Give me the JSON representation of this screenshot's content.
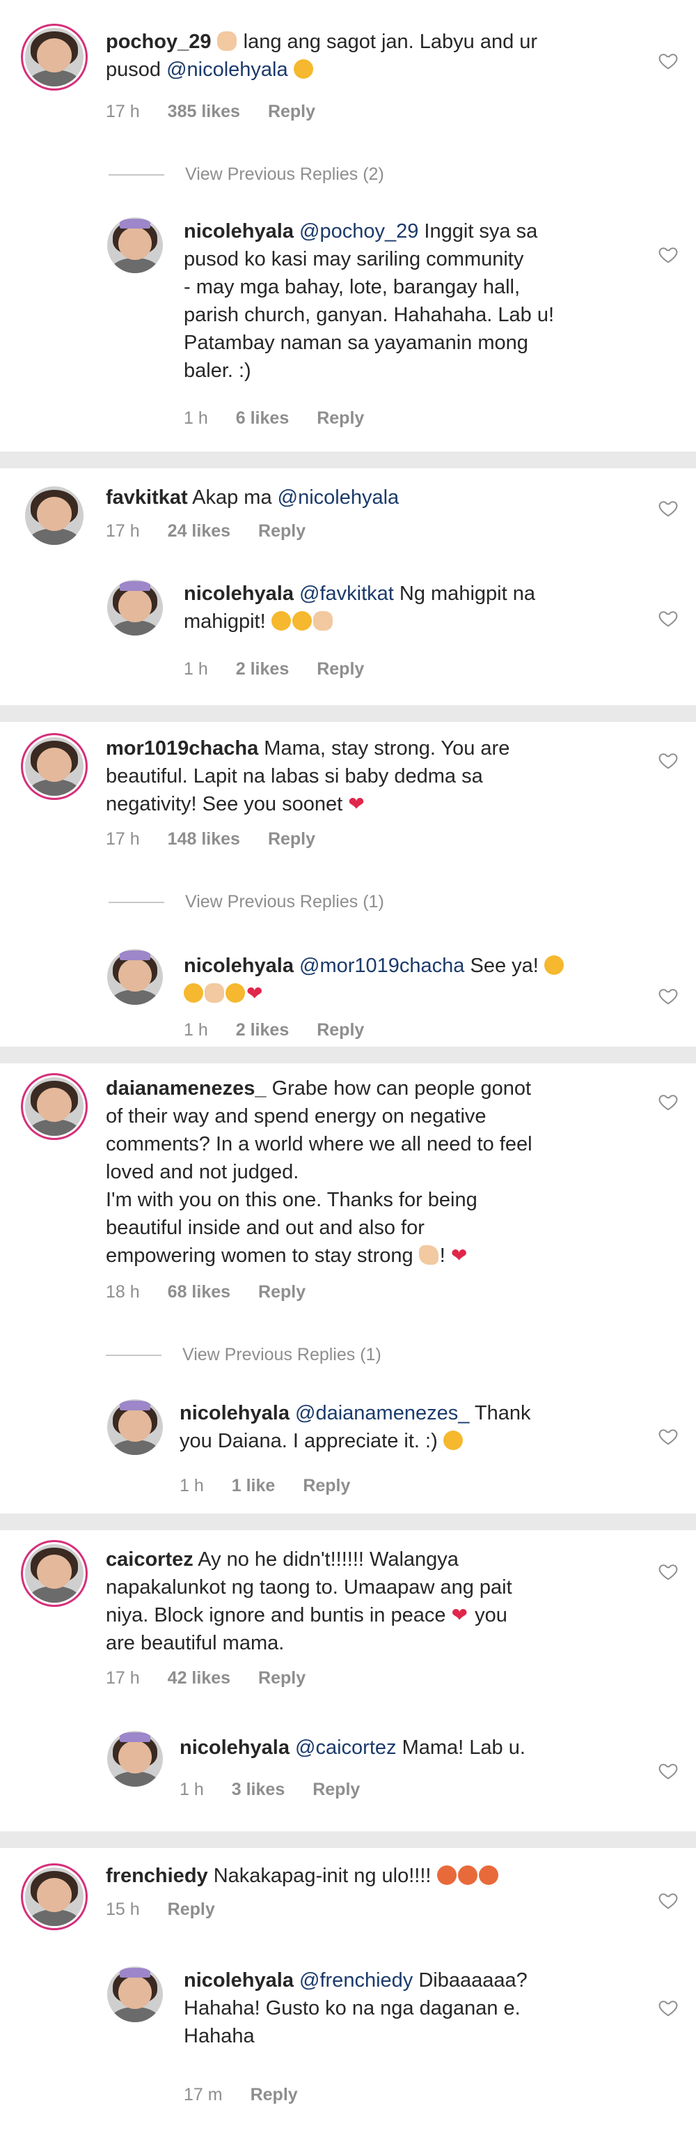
{
  "comments": [
    {
      "username": "pochoy_29",
      "text_before": " ",
      "text_after": " lang ang sagot jan. Labyu and ur\npusod ",
      "mention": "@nicolehyala",
      "time": "17 h",
      "likes": "385 likes",
      "reply_label": "Reply"
    },
    {
      "username": "nicolehyala",
      "mention": "@pochoy_29",
      "text": " Inggit sya sa\npusod ko kasi may sariling community\n- may mga bahay, lote, barangay hall,\nparish church, ganyan. Hahahaha. Lab u!\nPatambay naman sa yayamanin mong\nbaler. :)",
      "time": "1 h",
      "likes": "6 likes",
      "reply_label": "Reply"
    },
    {
      "username": "favkitkat",
      "text": " Akap ma ",
      "mention": "@nicolehyala",
      "time": "17 h",
      "likes": "24 likes",
      "reply_label": "Reply"
    },
    {
      "username": "nicolehyala",
      "mention": "@favkitkat",
      "text": " Ng mahigpit na\nmahigpit! ",
      "time": "1 h",
      "likes": "2 likes",
      "reply_label": "Reply"
    },
    {
      "username": "mor1019chacha",
      "text": " Mama, stay strong. You are\nbeautiful. Lapit na labas si baby dedma sa\nnegativity! See you soonet ",
      "time": "17 h",
      "likes": "148 likes",
      "reply_label": "Reply"
    },
    {
      "username": "nicolehyala",
      "mention": "@mor1019chacha",
      "text": " See ya! ",
      "time": "1 h",
      "likes": "2 likes",
      "reply_label": "Reply"
    },
    {
      "username": "daianamenezes_",
      "text": " Grabe how can people gonot\nof their way and spend energy on negative\ncomments? In a world where we all need to feel\nloved and not judged.\nI'm with you on this one. Thanks for being\nbeautiful inside and out and also for\nempowering women to stay strong ",
      "text_end": "!",
      "time": "18 h",
      "likes": "68 likes",
      "reply_label": "Reply"
    },
    {
      "username": "nicolehyala",
      "mention": "@daianamenezes_",
      "text": " Thank\nyou Daiana. I appreciate it. :) ",
      "time": "1 h",
      "likes": "1 like",
      "reply_label": "Reply"
    },
    {
      "username": "caicortez",
      "text": " Ay no he didn't!!!!!! Walangya\nnapakalunkot ng taong to. Umaapaw ang pait\nniya. Block ignore and buntis in peace ",
      "text_after": " you\nare beautiful mama.",
      "time": "17 h",
      "likes": "42 likes",
      "reply_label": "Reply"
    },
    {
      "username": "nicolehyala",
      "mention": "@caicortez",
      "text": " Mama! Lab u.",
      "time": "1 h",
      "likes": "3 likes",
      "reply_label": "Reply"
    },
    {
      "username": "frenchiedy",
      "text": " Nakakapag-init ng ulo!!!! ",
      "time": "15 h",
      "reply_label": "Reply"
    },
    {
      "username": "nicolehyala",
      "mention": "@frenchiedy",
      "text": " Dibaaaaaa?\nHahaha! Gusto ko na nga daganan e.\nHahaha",
      "time": "17 m",
      "reply_label": "Reply"
    }
  ],
  "view_previous": [
    "View Previous Replies (2)",
    "View Previous Replies (1)",
    "View Previous Replies (1)"
  ],
  "colors": {
    "mention": "#1b3a6b",
    "meta": "#8e8e8e",
    "story_ring": "#d62f7a",
    "heart_emoji": "#e0264b",
    "separator": "#e9e9e9"
  },
  "icons": {
    "like": "heart-outline-icon",
    "emoji_heart": "red-heart-emoji"
  }
}
